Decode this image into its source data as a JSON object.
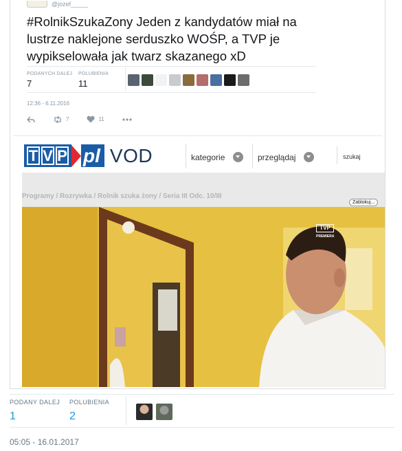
{
  "inner_tweet": {
    "handle": "@jozef_____",
    "hashtag": "#RolnikSzukaZony",
    "text": " Jeden z kandydatów miał na lustrze naklejone serduszko WOŚP, a TVP je wypikselowała jak twarz skazanego xD",
    "retweets_label": "PODANYCH DALEJ",
    "retweets_count": "7",
    "likes_label": "POLUBIENIA",
    "likes_count": "11",
    "date": "12:36 - 6.11.2016",
    "action_retweet_count": "7",
    "action_like_count": "11"
  },
  "vod": {
    "logo_pl": "pl",
    "logo_vod": "VOD",
    "nav_categories": "kategorie",
    "nav_browse": "przeglądaj",
    "search_placeholder": "szukaj",
    "breadcrumb": "Programy / Rozrywka / Rolnik szuka żony / Seria III Odc. 10/III",
    "blocked_button": "Zablokuj...",
    "video_watermark": "PREMIERA"
  },
  "outer_tweet": {
    "retweets_label": "PODANY DALEJ",
    "retweets_count": "1",
    "likes_label": "POLUBIENIA",
    "likes_count": "2",
    "date": "05:05 - 16.01.2017"
  },
  "colors": {
    "link_blue": "#1b95e0",
    "tvp_blue": "#1a5ca7",
    "tvp_red": "#e3272f",
    "wall_yellow": "#e9c547"
  }
}
